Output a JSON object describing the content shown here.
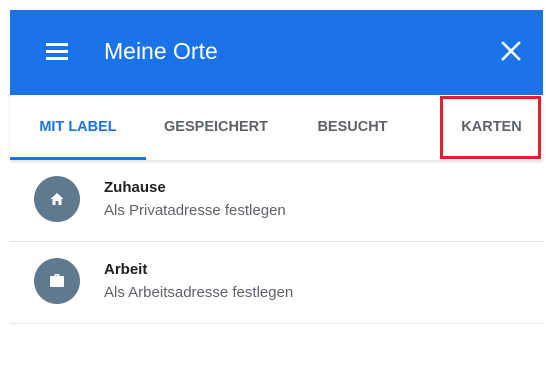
{
  "header": {
    "title": "Meine Orte",
    "menu_icon": "hamburger-menu-icon",
    "close_icon": "close-icon",
    "color": "#1a73e8"
  },
  "tabs": [
    {
      "label": "MIT LABEL",
      "active": true
    },
    {
      "label": "GESPEICHERT",
      "active": false
    },
    {
      "label": "BESUCHT",
      "active": false
    },
    {
      "label": "KARTEN",
      "active": false,
      "highlighted": true
    }
  ],
  "highlight_color": "#e0202b",
  "places": [
    {
      "title": "Zuhause",
      "subtitle": "Als Privatadresse festlegen",
      "icon": "home-icon"
    },
    {
      "title": "Arbeit",
      "subtitle": "Als Arbeitsadresse festlegen",
      "icon": "briefcase-icon"
    }
  ]
}
